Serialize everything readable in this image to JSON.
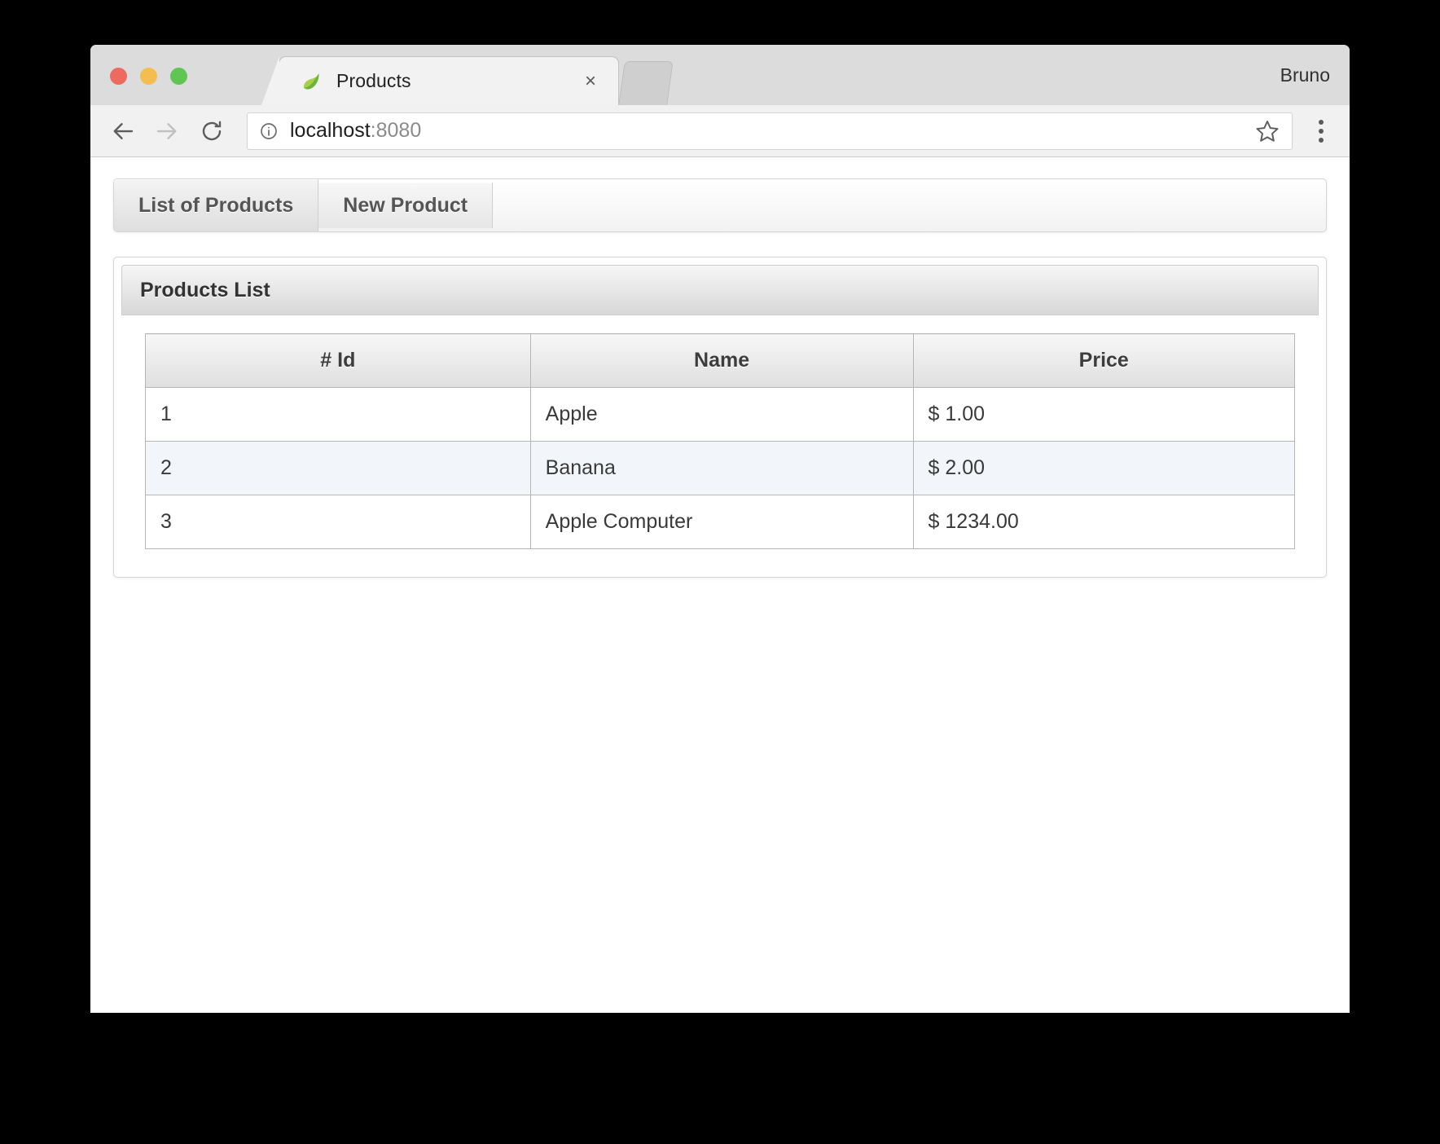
{
  "browser": {
    "tab": {
      "title": "Products",
      "favicon": "spring-leaf-icon",
      "close_label": "×"
    },
    "profile_name": "Bruno",
    "toolbar": {
      "back_label": "←",
      "forward_label": "→",
      "reload_label": "↻",
      "info_label": "i",
      "url_host": "localhost",
      "url_port": ":8080",
      "url_full": "localhost:8080",
      "star_label": "☆",
      "menu_label": "⋮"
    }
  },
  "navbar": {
    "items": [
      {
        "label": "List of Products",
        "active": true
      },
      {
        "label": "New Product",
        "active": false
      }
    ]
  },
  "panel": {
    "heading": "Products List",
    "table": {
      "columns": [
        "# Id",
        "Name",
        "Price"
      ],
      "rows": [
        {
          "id": "1",
          "name": "Apple",
          "price": "$ 1.00"
        },
        {
          "id": "2",
          "name": "Banana",
          "price": "$ 2.00"
        },
        {
          "id": "3",
          "name": "Apple Computer",
          "price": "$ 1234.00"
        }
      ]
    }
  },
  "colors": {
    "window_chrome": "#dcdcdc",
    "toolbar": "#f1f1f1",
    "page_bg": "#ffffff",
    "striped_row": "#f2f6fa",
    "traffic_red": "#ec6a5f",
    "traffic_yellow": "#f4bd4f",
    "traffic_green": "#61c555",
    "leaf_green": "#8cc63e"
  }
}
